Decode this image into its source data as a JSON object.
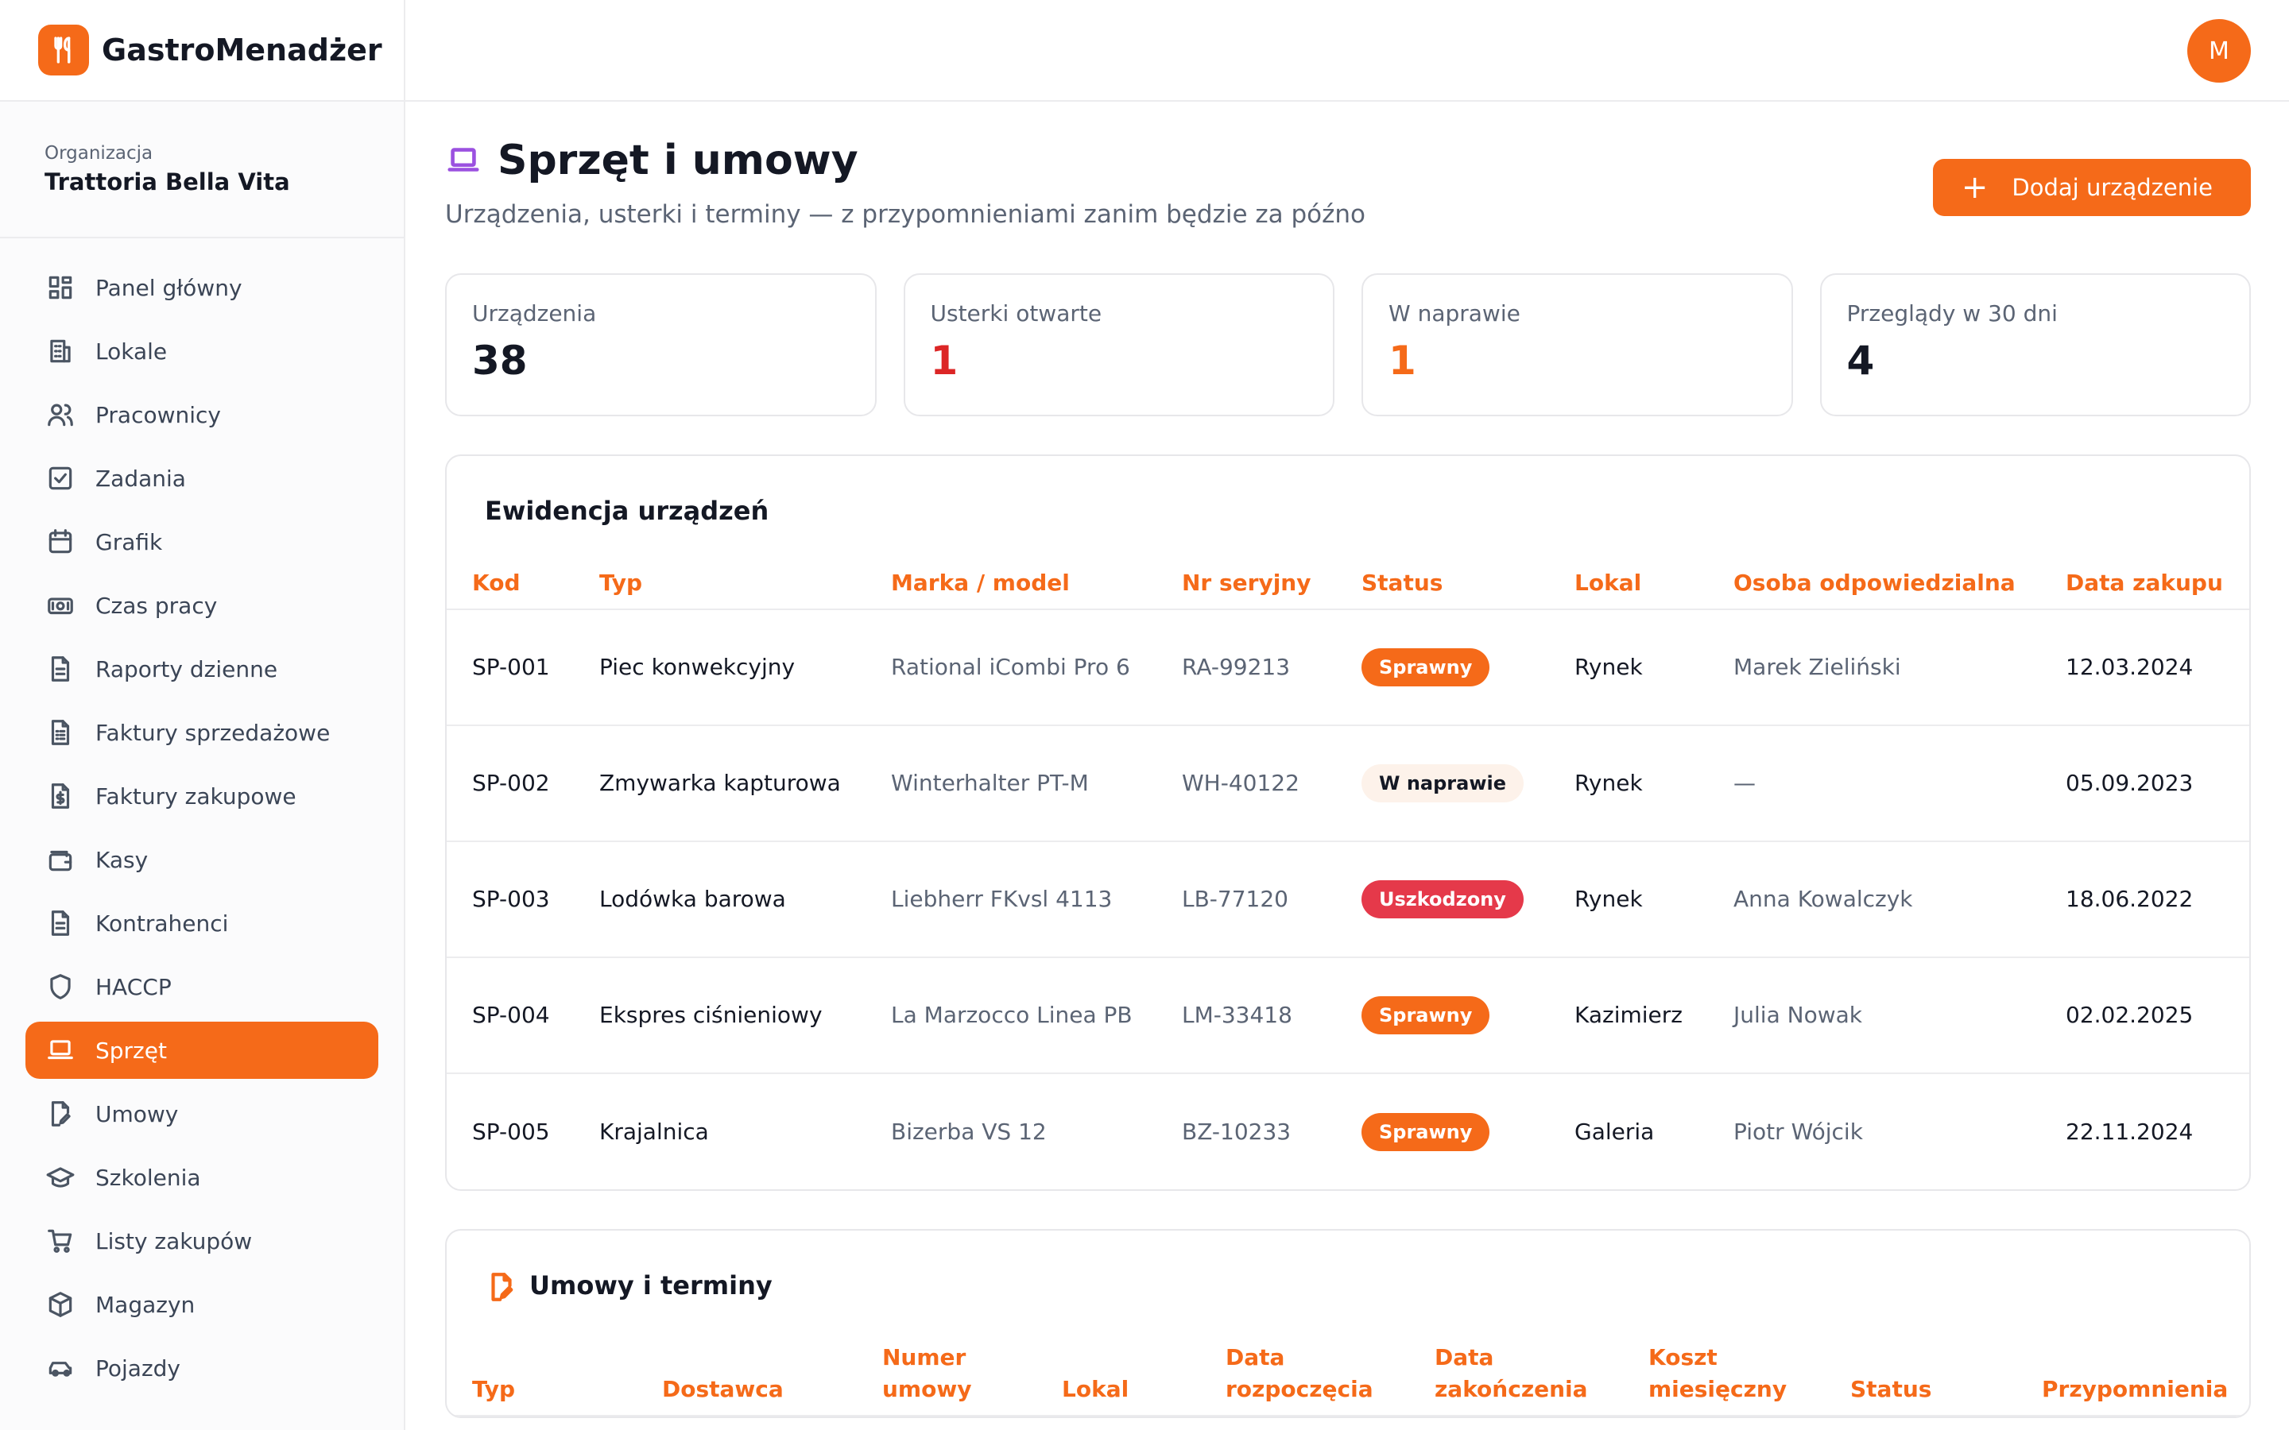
{
  "app": {
    "name": "GastroMenadżer",
    "avatar_initial": "M"
  },
  "org": {
    "label": "Organizacja",
    "name": "Trattoria Bella Vita"
  },
  "sidebar": {
    "items": [
      {
        "label": "Panel główny",
        "icon": "grid-icon"
      },
      {
        "label": "Lokale",
        "icon": "building-icon"
      },
      {
        "label": "Pracownicy",
        "icon": "users-icon"
      },
      {
        "label": "Zadania",
        "icon": "check-square-icon"
      },
      {
        "label": "Grafik",
        "icon": "calendar-icon"
      },
      {
        "label": "Czas pracy",
        "icon": "clock-card-icon"
      },
      {
        "label": "Raporty dzienne",
        "icon": "document-icon"
      },
      {
        "label": "Faktury sprzedażowe",
        "icon": "invoice-icon"
      },
      {
        "label": "Faktury zakupowe",
        "icon": "dollar-document-icon"
      },
      {
        "label": "Kasy",
        "icon": "wallet-icon"
      },
      {
        "label": "Kontrahenci",
        "icon": "document-icon"
      },
      {
        "label": "HACCP",
        "icon": "shield-icon"
      },
      {
        "label": "Sprzęt",
        "icon": "laptop-icon",
        "active": true
      },
      {
        "label": "Umowy",
        "icon": "edit-document-icon"
      },
      {
        "label": "Szkolenia",
        "icon": "graduation-cap-icon"
      },
      {
        "label": "Listy zakupów",
        "icon": "cart-icon"
      },
      {
        "label": "Magazyn",
        "icon": "box-icon"
      },
      {
        "label": "Pojazdy",
        "icon": "car-icon"
      }
    ]
  },
  "page": {
    "title": "Sprzęt i umowy",
    "subtitle": "Urządzenia, usterki i terminy — z przypomnieniami zanim będzie za późno",
    "add_button": "Dodaj urządzenie"
  },
  "stats": [
    {
      "label": "Urządzenia",
      "value": "38",
      "color": "#141824"
    },
    {
      "label": "Usterki otwarte",
      "value": "1",
      "color": "#dc2626"
    },
    {
      "label": "W naprawie",
      "value": "1",
      "color": "#f56a19"
    },
    {
      "label": "Przeglądy w 30 dni",
      "value": "4",
      "color": "#141824"
    }
  ],
  "equipment": {
    "title": "Ewidencja urządzeń",
    "columns": [
      "Kod",
      "Typ",
      "Marka / model",
      "Nr seryjny",
      "Status",
      "Lokal",
      "Osoba odpowiedzialna",
      "Data zakupu"
    ],
    "rows": [
      {
        "code": "SP-001",
        "type": "Piec konwekcyjny",
        "model": "Rational iCombi Pro 6",
        "serial": "RA-99213",
        "status": "Sprawny",
        "status_kind": "ok",
        "location": "Rynek",
        "person": "Marek Zieliński",
        "date": "12.03.2024"
      },
      {
        "code": "SP-002",
        "type": "Zmywarka kapturowa",
        "model": "Winterhalter PT-M",
        "serial": "WH-40122",
        "status": "W naprawie",
        "status_kind": "repair",
        "location": "Rynek",
        "person": "—",
        "date": "05.09.2023"
      },
      {
        "code": "SP-003",
        "type": "Lodówka barowa",
        "model": "Liebherr FKvsl 4113",
        "serial": "LB-77120",
        "status": "Uszkodzony",
        "status_kind": "broken",
        "location": "Rynek",
        "person": "Anna Kowalczyk",
        "date": "18.06.2022"
      },
      {
        "code": "SP-004",
        "type": "Ekspres ciśnieniowy",
        "model": "La Marzocco Linea PB",
        "serial": "LM-33418",
        "status": "Sprawny",
        "status_kind": "ok",
        "location": "Kazimierz",
        "person": "Julia Nowak",
        "date": "02.02.2025"
      },
      {
        "code": "SP-005",
        "type": "Krajalnica",
        "model": "Bizerba VS 12",
        "serial": "BZ-10233",
        "status": "Sprawny",
        "status_kind": "ok",
        "location": "Galeria",
        "person": "Piotr Wójcik",
        "date": "22.11.2024"
      }
    ]
  },
  "contracts": {
    "title": "Umowy i terminy",
    "columns": [
      "Typ",
      "Dostawca",
      "Numer umowy",
      "Lokal",
      "Data rozpoczęcia",
      "Data zakończenia",
      "Koszt miesięczny",
      "Status",
      "Przypomnienia"
    ]
  },
  "colors": {
    "accent": "#f56a19",
    "ok": "#f56a19",
    "broken": "#e5394a",
    "repair_bg": "#fdf2ea",
    "repair_text": "#141824"
  }
}
